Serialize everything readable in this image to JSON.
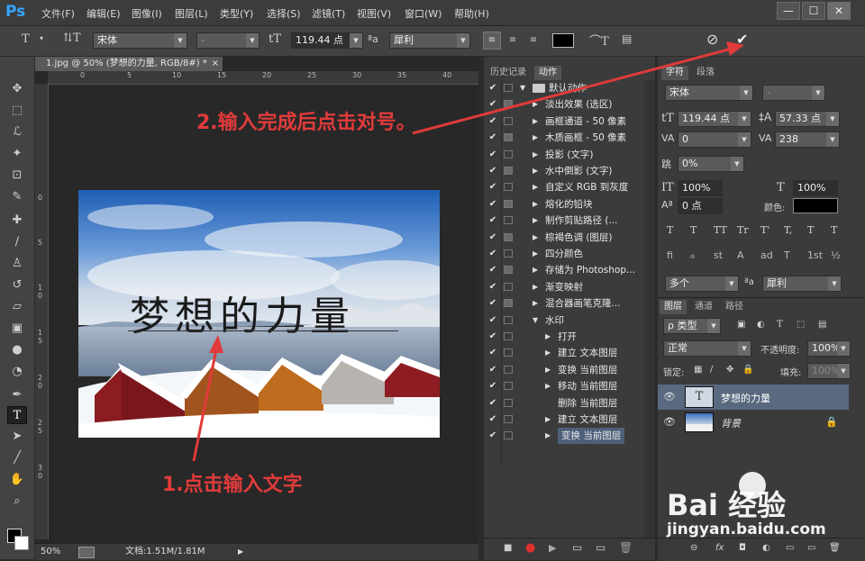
{
  "app": {
    "logo": "Ps"
  },
  "menu": [
    "文件(F)",
    "编辑(E)",
    "图像(I)",
    "图层(L)",
    "类型(Y)",
    "选择(S)",
    "滤镜(T)",
    "视图(V)",
    "窗口(W)",
    "帮助(H)"
  ],
  "window_buttons": [
    "—",
    "☐",
    "✕"
  ],
  "options": {
    "font_family": "宋体",
    "font_style": "-",
    "font_size": "119.44 点",
    "aa_label": "ªa",
    "antialias": "犀利",
    "text_color": "#000000",
    "cancel_icon": "⊘",
    "commit_icon": "✔"
  },
  "document": {
    "tab_title": "1.jpg @ 50% (梦想的力量, RGB/8#) *",
    "close": "×",
    "ruler_top": [
      "0",
      "5",
      "10",
      "15",
      "20",
      "25",
      "30",
      "35",
      "40",
      "45"
    ],
    "ruler_left": [
      "0",
      "5",
      "1 0",
      "1 5",
      "2 0",
      "2 5",
      "3 0"
    ],
    "canvas_text": "梦想的力量",
    "zoom": "50%",
    "doc_info": "文档:1.51M/1.81M"
  },
  "actions_panel": {
    "tabs": [
      "历史记录",
      "动作"
    ],
    "active_tab": "动作",
    "rows": [
      {
        "label": "默认动作",
        "indent": 0,
        "arrow": "▼",
        "folder": true
      },
      {
        "label": "淡出效果 (选区)",
        "indent": 1,
        "arrow": "▶"
      },
      {
        "label": "画框通道 - 50 像素",
        "indent": 1,
        "arrow": "▶"
      },
      {
        "label": "木质画框 - 50 像素",
        "indent": 1,
        "arrow": "▶"
      },
      {
        "label": "投影 (文字)",
        "indent": 1,
        "arrow": "▶"
      },
      {
        "label": "水中倒影 (文字)",
        "indent": 1,
        "arrow": "▶"
      },
      {
        "label": "自定义 RGB 到灰度",
        "indent": 1,
        "arrow": "▶"
      },
      {
        "label": "熔化的铅块",
        "indent": 1,
        "arrow": "▶"
      },
      {
        "label": "制作剪贴路径 (...",
        "indent": 1,
        "arrow": "▶"
      },
      {
        "label": "棕褐色调 (图层)",
        "indent": 1,
        "arrow": "▶"
      },
      {
        "label": "四分颜色",
        "indent": 1,
        "arrow": "▶"
      },
      {
        "label": "存储为 Photoshop...",
        "indent": 1,
        "arrow": "▶"
      },
      {
        "label": "渐变映射",
        "indent": 1,
        "arrow": "▶"
      },
      {
        "label": "混合器画笔克隆...",
        "indent": 1,
        "arrow": "▶"
      },
      {
        "label": "水印",
        "indent": 1,
        "arrow": "▼"
      },
      {
        "label": "打开",
        "indent": 2,
        "arrow": "▶"
      },
      {
        "label": "建立 文本图层",
        "indent": 2,
        "arrow": "▶"
      },
      {
        "label": "变换 当前图层",
        "indent": 2,
        "arrow": "▶"
      },
      {
        "label": "移动 当前图层",
        "indent": 2,
        "arrow": "▶"
      },
      {
        "label": "删除 当前图层",
        "indent": 2,
        "arrow": ""
      },
      {
        "label": "建立 文本图层",
        "indent": 2,
        "arrow": "▶"
      },
      {
        "label": "变换 当前图层",
        "indent": 2,
        "arrow": "▶",
        "selected": true
      }
    ],
    "check": "✔",
    "footer_icons": [
      "■",
      "●",
      "▶",
      "▭",
      "▭",
      "🗑"
    ]
  },
  "char_panel": {
    "tabs": [
      "字符",
      "段落"
    ],
    "font_family": "宋体",
    "font_style": "-",
    "size": "119.44 点",
    "leading": "57.33 点",
    "kerning": "0",
    "tracking": "238",
    "scale_pct": "0%",
    "vscale": "100%",
    "hscale": "100%",
    "baseline": "0 点",
    "color_label": "颜色:",
    "language": "多个",
    "aa": "犀利",
    "style_buttons": [
      "T",
      "T",
      "TT",
      "Tr",
      "T'",
      "T,",
      "T",
      "T"
    ],
    "ot_buttons": [
      "fi",
      "ℴ",
      "st",
      "A",
      "ad",
      "T",
      "1st",
      "½"
    ]
  },
  "layers_panel": {
    "tabs": [
      "图层",
      "通道",
      "路径"
    ],
    "filter": "ρ 类型",
    "blend": "正常",
    "opacity_label": "不透明度:",
    "opacity": "100%",
    "lock_label": "锁定:",
    "fill_label": "填充:",
    "fill": "100%",
    "layers": [
      {
        "name": "梦想的力量",
        "type": "text",
        "selected": true
      },
      {
        "name": "背景",
        "type": "image",
        "locked": true
      }
    ],
    "footer_icons": [
      "⊖",
      "fx",
      "◘",
      "◐",
      "▭",
      "▭",
      "🗑"
    ]
  },
  "annotations": {
    "step1": "1.点击输入文字",
    "step2": "2.输入完成后点击对号。"
  },
  "watermark": {
    "brand": "Bai 经验",
    "url": "jingyan.baidu.com"
  }
}
